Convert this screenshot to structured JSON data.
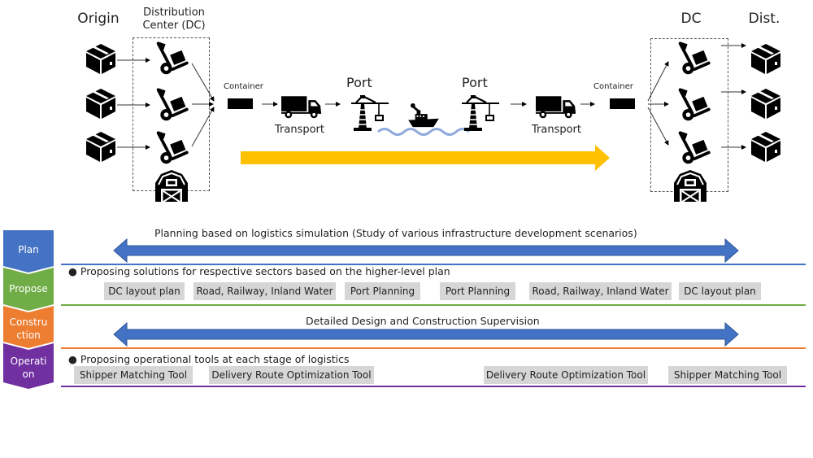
{
  "diagram": {
    "headers": {
      "origin": "Origin",
      "distribution_center": "Distribution Center (DC)",
      "dc": "DC",
      "dist": "Dist."
    },
    "flow": {
      "container_left": "Container",
      "container_right": "Container",
      "transport_left": "Transport",
      "transport_right": "Transport",
      "port_left": "Port",
      "port_right": "Port"
    },
    "icons": {
      "origin": [
        "box-icon",
        "box-icon",
        "box-icon"
      ],
      "dc_left": [
        "hand-truck-icon",
        "hand-truck-icon",
        "hand-truck-icon",
        "warehouse-barn-icon"
      ],
      "transport": [
        "truck-icon",
        "port-crane-icon",
        "ship-icon",
        "port-crane-icon",
        "truck-icon"
      ],
      "dc_right": [
        "hand-truck-icon",
        "hand-truck-icon",
        "hand-truck-icon",
        "warehouse-barn-icon"
      ],
      "destination": [
        "box-icon",
        "box-icon",
        "box-icon"
      ]
    },
    "colors": {
      "flow_arrow": "#FFC000",
      "double_arrow": "#4472C4",
      "water": "#8EA9DB",
      "plan": "#4472C4",
      "propose": "#70AD47",
      "construction": "#ED7D31",
      "operation": "#7030A0",
      "tag_bg": "#D6D6D6"
    }
  },
  "stages": [
    {
      "name": "Plan",
      "label_lines": [
        "Plan"
      ],
      "description": "Planning based on logistics simulation (Study of various infrastructure development scenarios)"
    },
    {
      "name": "Propose",
      "label_lines": [
        "Propose"
      ],
      "bullet": "Proposing solutions for respective sectors based on the higher-level plan",
      "tags": [
        "DC layout plan",
        "Road, Railway, Inland Water",
        "Port Planning",
        "Port Planning",
        "Road, Railway, Inland Water",
        "DC layout plan"
      ]
    },
    {
      "name": "Construction",
      "label_lines": [
        "Constru",
        "ction"
      ],
      "description": "Detailed Design and Construction Supervision"
    },
    {
      "name": "Operation",
      "label_lines": [
        "Operati",
        "on"
      ],
      "bullet": "Proposing operational tools at each stage of logistics",
      "tags": [
        "Shipper Matching Tool",
        "Delivery Route Optimization Tool",
        "Delivery Route Optimization Tool",
        "Shipper Matching Tool"
      ]
    }
  ]
}
